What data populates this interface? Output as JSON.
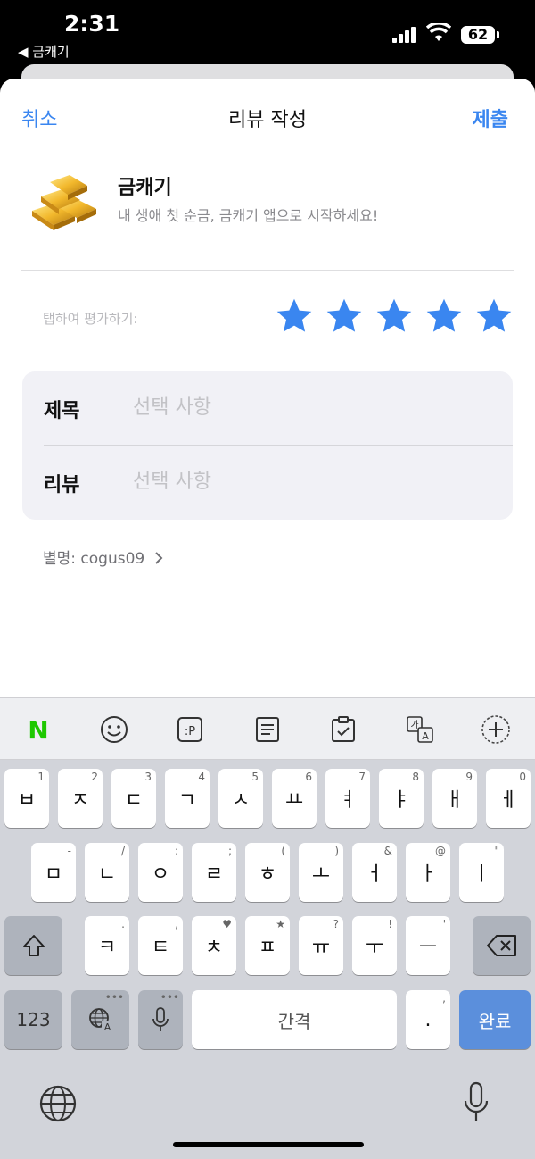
{
  "status_bar": {
    "time": "2:31",
    "back_app": "◀ 금캐기",
    "battery": "62"
  },
  "nav": {
    "cancel": "취소",
    "title": "리뷰 작성",
    "submit": "제출"
  },
  "app": {
    "name": "금캐기",
    "subtitle": "내 생애 첫 순금, 금캐기 앱으로 시작하세요!"
  },
  "rating": {
    "label": "탭하여 평가하기:",
    "star_count": 5,
    "star_color": "#3a86f0"
  },
  "form": {
    "title_label": "제목",
    "title_placeholder": "선택 사항",
    "review_label": "리뷰",
    "review_placeholder": "선택 사항"
  },
  "nickname": "별명: cogus09",
  "keyboard": {
    "toolbar": [
      "n-logo-icon",
      "emoji-icon",
      "clipboard-p-icon",
      "memo-icon",
      "checklist-icon",
      "translate-icon",
      "add-icon"
    ],
    "n_logo": "N",
    "row1": [
      {
        "k": "ㅂ",
        "h": "1"
      },
      {
        "k": "ㅈ",
        "h": "2"
      },
      {
        "k": "ㄷ",
        "h": "3"
      },
      {
        "k": "ㄱ",
        "h": "4"
      },
      {
        "k": "ㅅ",
        "h": "5"
      },
      {
        "k": "ㅛ",
        "h": "6"
      },
      {
        "k": "ㅕ",
        "h": "7"
      },
      {
        "k": "ㅑ",
        "h": "8"
      },
      {
        "k": "ㅐ",
        "h": "9"
      },
      {
        "k": "ㅔ",
        "h": "0"
      }
    ],
    "row2": [
      {
        "k": "ㅁ",
        "h": "-"
      },
      {
        "k": "ㄴ",
        "h": "/"
      },
      {
        "k": "ㅇ",
        "h": ":"
      },
      {
        "k": "ㄹ",
        "h": ";"
      },
      {
        "k": "ㅎ",
        "h": "("
      },
      {
        "k": "ㅗ",
        "h": ")"
      },
      {
        "k": "ㅓ",
        "h": "&"
      },
      {
        "k": "ㅏ",
        "h": "@"
      },
      {
        "k": "ㅣ",
        "h": "\""
      }
    ],
    "row3": [
      {
        "k": "ㅋ",
        "h": "."
      },
      {
        "k": "ㅌ",
        "h": ","
      },
      {
        "k": "ㅊ",
        "h": "♥"
      },
      {
        "k": "ㅍ",
        "h": "★"
      },
      {
        "k": "ㅠ",
        "h": "?"
      },
      {
        "k": "ㅜ",
        "h": "!"
      },
      {
        "k": "ㅡ",
        "h": "'"
      }
    ],
    "numbers": "123",
    "space": "간격",
    "period": ".",
    "period_hint": ",",
    "done": "완료"
  }
}
